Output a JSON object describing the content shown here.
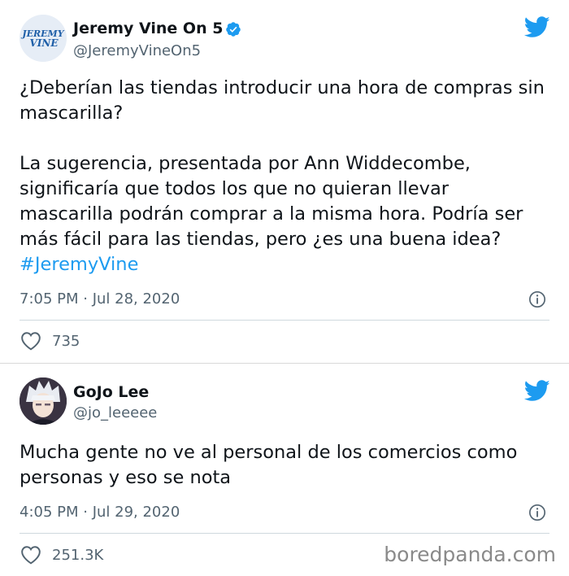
{
  "tweet1": {
    "avatar_text_top": "JEREMY",
    "avatar_text_bottom": "VINE",
    "name": "Jeremy Vine On 5",
    "handle": "@JeremyVineOn5",
    "paragraph1": "¿Deberían las tiendas introducir una hora de compras sin mascarilla?",
    "paragraph2": "La sugerencia, presentada por Ann Widdecombe, significaría que todos los que no quieran llevar mascarilla podrán comprar a la misma hora. Podría ser más fácil para las tiendas, pero ¿es una buena idea?",
    "hashtag": "#JeremyVine",
    "timestamp": "7:05 PM · Jul 28, 2020",
    "likes": "735"
  },
  "tweet2": {
    "name": "GoJo Lee",
    "handle": "@jo_leeeee",
    "text": "Mucha gente no ve al personal de los comercios como personas y eso se nota",
    "timestamp": "4:05 PM · Jul 29, 2020",
    "likes": "251.3K"
  },
  "watermark": "boredpanda.com",
  "colors": {
    "twitter_blue": "#1d9bf0",
    "secondary_text": "#536471",
    "primary_text": "#0f1419"
  }
}
